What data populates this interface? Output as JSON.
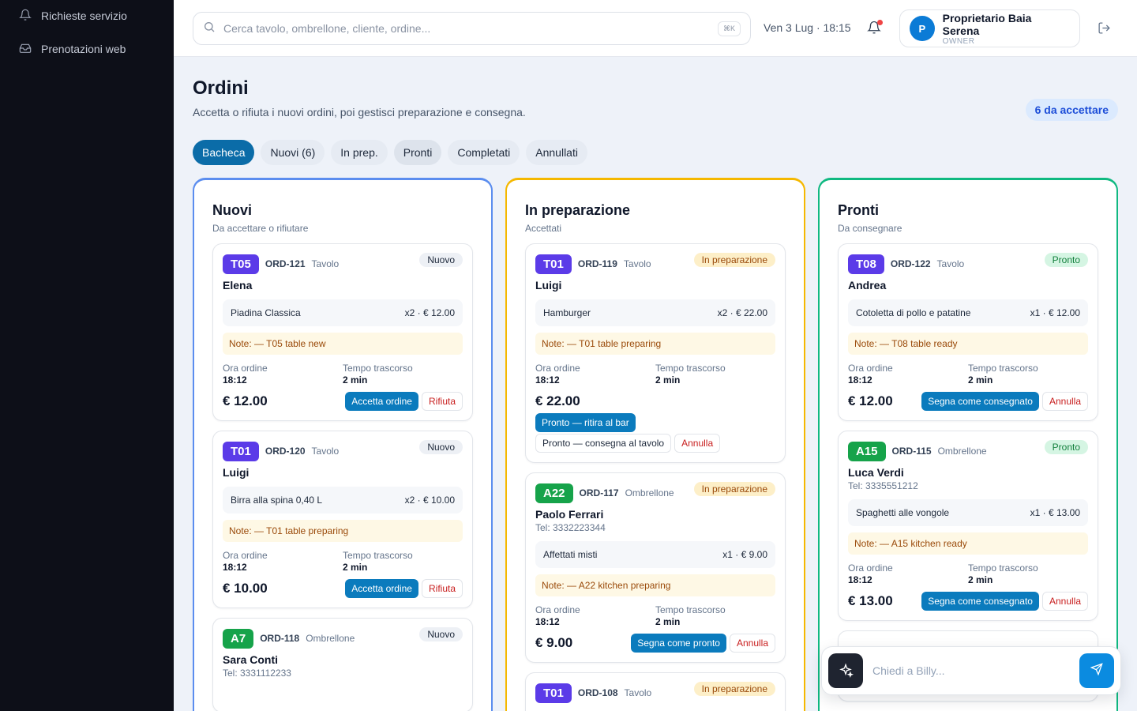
{
  "sidebar": {
    "items": [
      {
        "label": "Richieste servizio",
        "icon": "bell-icon"
      },
      {
        "label": "Prenotazioni web",
        "icon": "inbox-icon"
      }
    ]
  },
  "topbar": {
    "search_placeholder": "Cerca tavolo, ombrellone, cliente, ordine...",
    "shortcut": "⌘K",
    "datetime": "Ven 3 Lug · 18:15",
    "user": {
      "initial": "P",
      "name": "Proprietario Baia Serena",
      "role": "OWNER"
    }
  },
  "page": {
    "title": "Ordini",
    "subtitle": "Accetta o rifiuta i nuovi ordini, poi gestisci preparazione e consegna.",
    "pending_badge": "6 da accettare"
  },
  "tabs": [
    "Bacheca",
    "Nuovi (6)",
    "In prep.",
    "Pronti",
    "Completati",
    "Annullati"
  ],
  "labels": {
    "ora_ordine": "Ora ordine",
    "tempo_trascorso": "Tempo trascorso"
  },
  "colors": {
    "new": "#5b8def",
    "prep": "#f5b800",
    "ready": "#10b981",
    "table_badge": "#5b3be8",
    "umbrella_badge": "#16a34a",
    "primary": "#0b7bbd"
  },
  "columns": [
    {
      "title": "Nuovi",
      "subtitle": "Da accettare o rifiutare",
      "cards": [
        {
          "code": "T05",
          "order": "ORD-121",
          "type": "Tavolo",
          "status": "Nuovo",
          "name": "Elena",
          "item": "Piadina Classica",
          "qty": "x2 · € 12.00",
          "note": "Note: — T05 table new",
          "time": "18:12",
          "elapsed": "2 min",
          "total": "€ 12.00",
          "primary": "Accetta ordine",
          "danger": "Rifiuta"
        },
        {
          "code": "T01",
          "order": "ORD-120",
          "type": "Tavolo",
          "status": "Nuovo",
          "name": "Luigi",
          "item": "Birra alla spina 0,40 L",
          "qty": "x2 · € 10.00",
          "note": "Note: — T01 table preparing",
          "time": "18:12",
          "elapsed": "2 min",
          "total": "€ 10.00",
          "primary": "Accetta ordine",
          "danger": "Rifiuta"
        },
        {
          "code": "A7",
          "order": "ORD-118",
          "type": "Ombrellone",
          "status": "Nuovo",
          "name": "Sara Conti",
          "tel": "Tel: 3331112233"
        }
      ]
    },
    {
      "title": "In preparazione",
      "subtitle": "Accettati",
      "cards": [
        {
          "code": "T01",
          "order": "ORD-119",
          "type": "Tavolo",
          "status": "In preparazione",
          "name": "Luigi",
          "item": "Hamburger",
          "qty": "x2 · € 22.00",
          "note": "Note: — T01 table preparing",
          "time": "18:12",
          "elapsed": "2 min",
          "total": "€ 22.00",
          "bar_btn": "Pronto — ritira al bar",
          "table_btn": "Pronto — consegna al tavolo",
          "danger": "Annulla"
        },
        {
          "code": "A22",
          "order": "ORD-117",
          "type": "Ombrellone",
          "status": "In preparazione",
          "name": "Paolo Ferrari",
          "tel": "Tel: 3332223344",
          "item": "Affettati misti",
          "qty": "x1 · € 9.00",
          "note": "Note: — A22 kitchen preparing",
          "time": "18:12",
          "elapsed": "2 min",
          "total": "€ 9.00",
          "primary": "Segna come pronto",
          "danger": "Annulla"
        },
        {
          "code": "T01",
          "order": "ORD-108",
          "type": "Tavolo",
          "status": "In preparazione"
        }
      ]
    },
    {
      "title": "Pronti",
      "subtitle": "Da consegnare",
      "cards": [
        {
          "code": "T08",
          "order": "ORD-122",
          "type": "Tavolo",
          "status": "Pronto",
          "name": "Andrea",
          "item": "Cotoletta di pollo e patatine",
          "qty": "x1 · € 12.00",
          "note": "Note: — T08 table ready",
          "time": "18:12",
          "elapsed": "2 min",
          "total": "€ 12.00",
          "primary": "Segna come consegnato",
          "danger": "Annulla"
        },
        {
          "code": "A15",
          "order": "ORD-115",
          "type": "Ombrellone",
          "status": "Pronto",
          "name": "Luca Verdi",
          "tel": "Tel: 3335551212",
          "item": "Spaghetti alle vongole",
          "qty": "x1 · € 13.00",
          "note": "Note: — A15 kitchen ready",
          "time": "18:12",
          "elapsed": "2 min",
          "total": "€ 13.00",
          "primary": "Segna come consegnato",
          "danger": "Annulla"
        }
      ]
    }
  ],
  "billy": {
    "placeholder": "Chiedi a Billy..."
  }
}
